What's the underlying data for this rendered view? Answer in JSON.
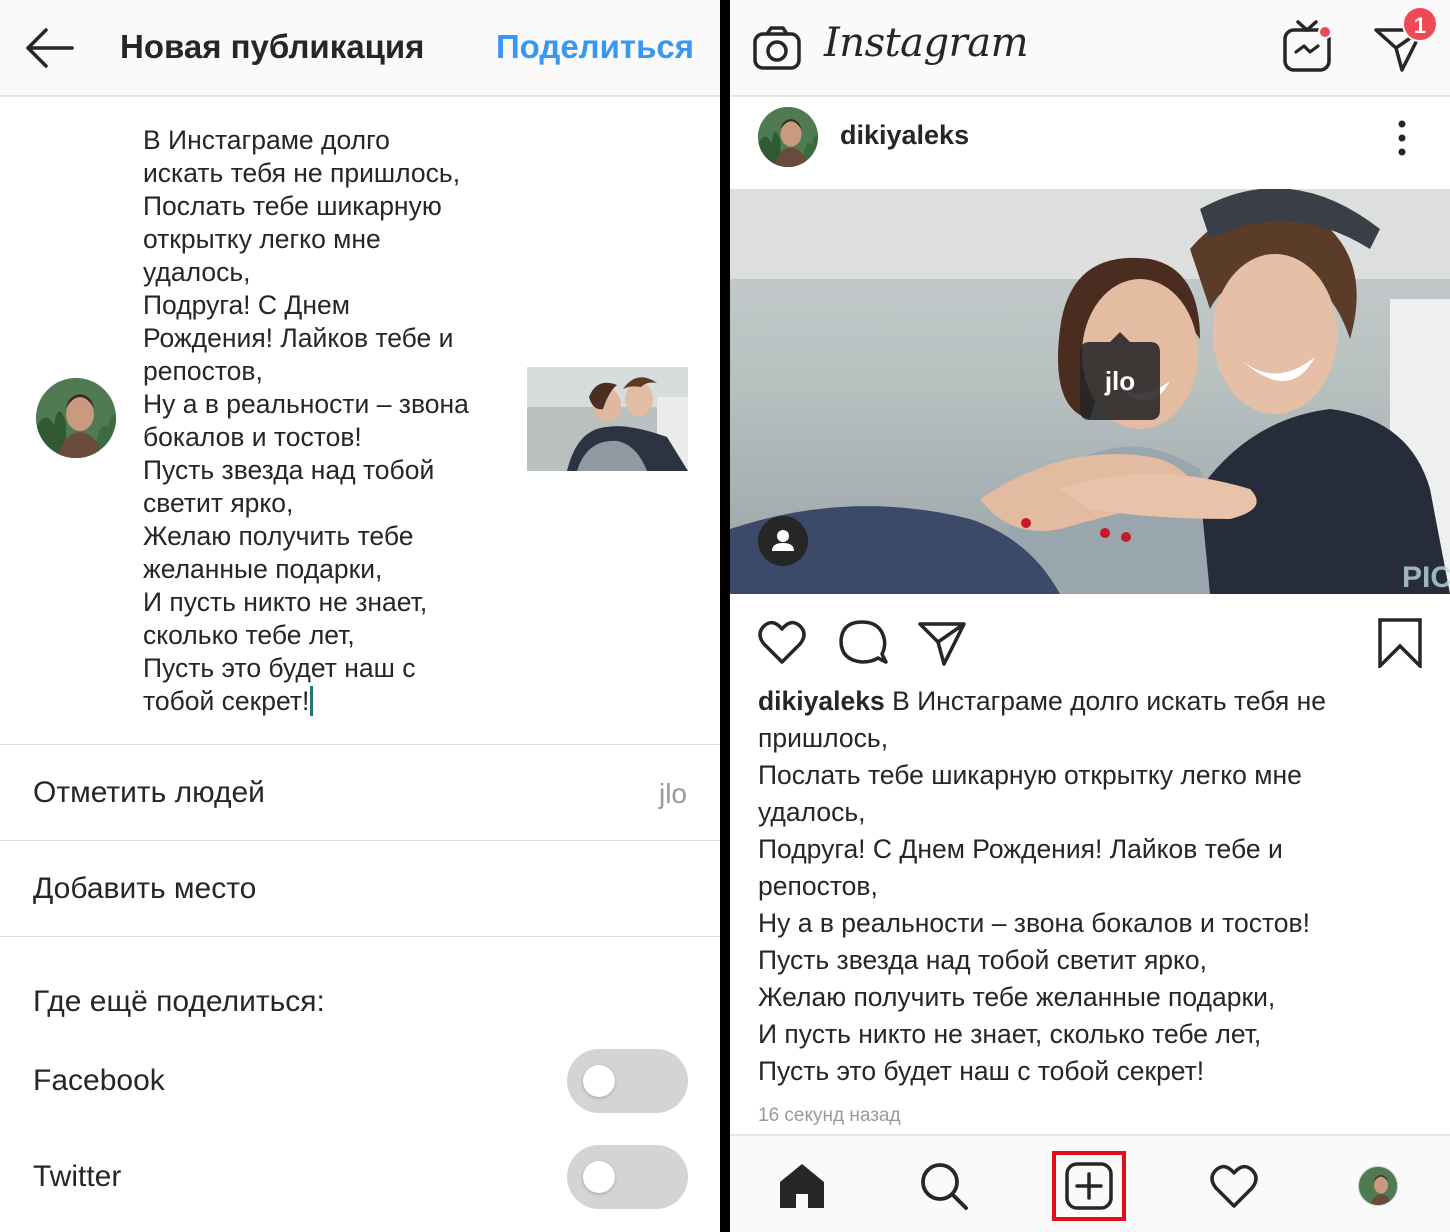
{
  "colors": {
    "accent_blue": "#3897f0",
    "text_primary": "#262626",
    "text_secondary": "#999999",
    "badge_red": "#ed4956",
    "highlight_red": "#e0101a",
    "toggle_off": "#d4d4d4"
  },
  "left": {
    "header": {
      "back_icon": "arrow-left-icon",
      "title": "Новая публикация",
      "share_label": "Поделиться"
    },
    "caption": "В Инстаграме долго\nискать тебя не пришлось,\nПослать тебе шикарную\nоткрытку легко мне\nудалось,\nПодруга! С Днем\nРождения! Лайков тебе и\nрепостов,\nНу а в реальности – звона\nбокалов и тостов!\nПусть звезда над тобой\nсветит ярко,\nЖелаю получить тебе\nжеланные подарки,\nИ пусть никто не знает,\nсколько тебе лет,\nПусть это будет наш с\nтобой секрет!",
    "tag_people": {
      "label": "Отметить людей",
      "value": "jlo"
    },
    "add_location": {
      "label": "Добавить место"
    },
    "share_elsewhere": {
      "title": "Где ещё поделиться:",
      "options": [
        {
          "label": "Facebook",
          "enabled": false
        },
        {
          "label": "Twitter",
          "enabled": false
        }
      ]
    }
  },
  "right": {
    "topbar": {
      "logo": "Instagram",
      "camera_icon": "camera-icon",
      "igtv_icon": "igtv-icon",
      "direct_icon": "direct-message-icon",
      "direct_badge": "1"
    },
    "post": {
      "username": "dikiyaleks",
      "photo_tag": "jlo",
      "caption_user": "dikiyaleks",
      "caption_text": " В Инстаграме долго искать тебя не\nпришлось,\nПослать тебе шикарную открытку легко мне\nудалось,\nПодруга! С Днем Рождения! Лайков тебе и\nрепостов,\nНу а в реальности – звона бокалов и тостов!\nПусть звезда над тобой светит ярко,\nЖелаю получить тебе желанные подарки,\nИ пусть никто не знает, сколько тебе лет,\nПусть это будет наш с тобой секрет!",
      "timestamp": "16 секунд назад",
      "watermark": "PIC"
    },
    "actions": [
      "heart-icon",
      "comment-icon",
      "share-icon",
      "bookmark-icon"
    ],
    "bottom_nav": [
      "home-icon",
      "search-icon",
      "new-post-icon",
      "activity-heart-icon",
      "profile-avatar"
    ]
  }
}
